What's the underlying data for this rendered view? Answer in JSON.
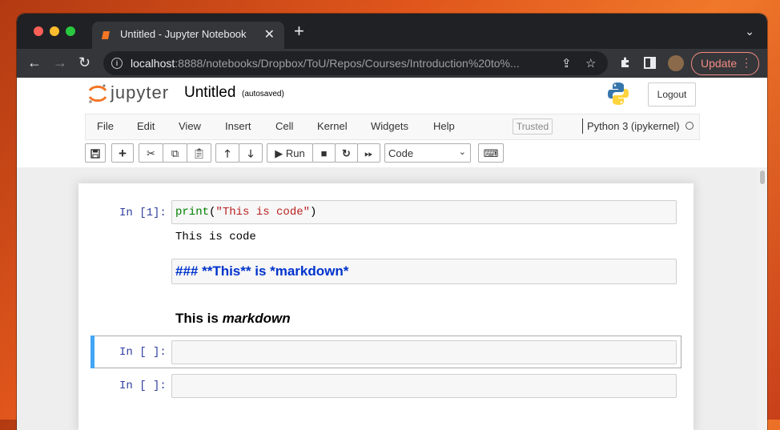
{
  "browser": {
    "tab_title": "Untitled - Jupyter Notebook",
    "tab_close": "✕",
    "new_tab": "+",
    "tab_menu": "⌄",
    "url_host": "localhost",
    "url_rest": ":8888/notebooks/Dropbox/ToU/Repos/Courses/Introduction%20to%...",
    "update_label": "Update",
    "update_dots": "⋮",
    "colors": {
      "close": "#ff5f57",
      "minimize": "#febc2e",
      "zoom": "#28c840",
      "update": "#f28b82"
    }
  },
  "jupyter": {
    "logo_text": "jupyter",
    "notebook_title": "Untitled",
    "save_status": "(autosaved)",
    "logout_label": "Logout",
    "menu": [
      "File",
      "Edit",
      "View",
      "Insert",
      "Cell",
      "Kernel",
      "Widgets",
      "Help"
    ],
    "trusted_label": "Trusted",
    "kernel_name": "Python 3 (ipykernel)",
    "run_label": "Run",
    "cell_type": "Code"
  },
  "cells": {
    "c1_prompt": "In [1]:",
    "c1_code_fn": "print",
    "c1_code_open": "(",
    "c1_code_str": "\"This is code\"",
    "c1_code_close": ")",
    "c1_output": "This is code",
    "md_source": "### **This** is *markdown*",
    "md_render_bold": "This is ",
    "md_render_italic": "markdown",
    "c3_prompt": "In [ ]:",
    "c4_prompt": "In [ ]:"
  }
}
